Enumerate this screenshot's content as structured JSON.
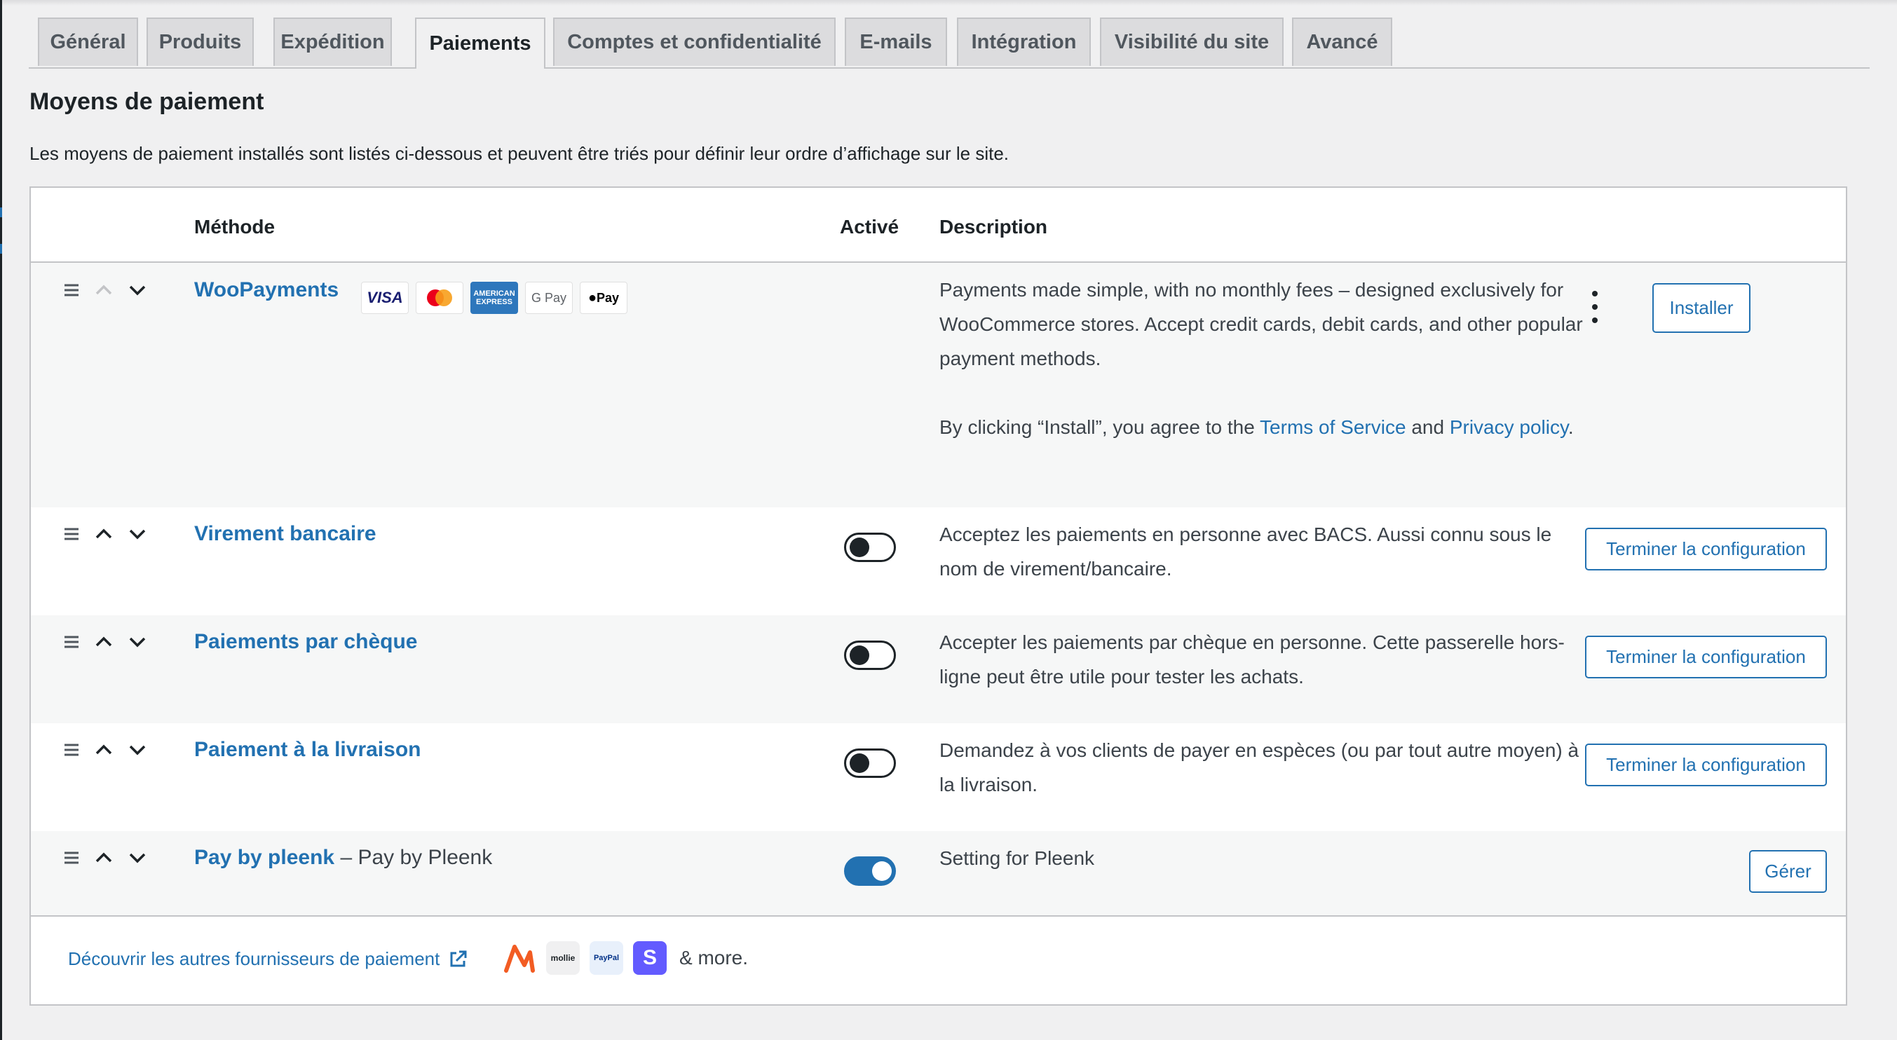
{
  "tabs": [
    "Général",
    "Produits",
    "Expédition",
    "Paiements",
    "Comptes et confidentialité",
    "E-mails",
    "Intégration",
    "Visibilité du site",
    "Avancé"
  ],
  "page": {
    "title": "Moyens de paiement",
    "description": "Les moyens de paiement installés sont listés ci-dessous et peuvent être triés pour définir leur ordre d’affichage sur le site."
  },
  "table": {
    "headers": {
      "method": "Méthode",
      "enabled": "Activé",
      "description": "Description"
    }
  },
  "woopayments": {
    "name": "WooPayments",
    "card_labels": {
      "visa": "VISA",
      "amex": "AMERICAN EXPRESS",
      "gpay": "G Pay",
      "applepay": "Pay"
    },
    "description": "Payments made simple, with no monthly fees – designed exclusively for WooCommerce stores. Accept credit cards, debit cards, and other popular payment methods.",
    "terms_prefix": "By clicking “Install”, you agree to the ",
    "terms_link": "Terms of Service",
    "terms_and": " and ",
    "privacy_link": "Privacy policy",
    "terms_suffix": ".",
    "install_label": "Installer"
  },
  "methods": [
    {
      "name": "Virement bancaire",
      "enabled": false,
      "description": "Acceptez les paiements en personne avec BACS. Aussi connu sous le nom de virement/bancaire.",
      "action": "Terminer la configuration"
    },
    {
      "name": "Paiements par chèque",
      "enabled": false,
      "description": "Accepter les paiements par chèque en personne. Cette passerelle hors-ligne peut être utile pour tester les achats.",
      "action": "Terminer la configuration"
    },
    {
      "name": "Paiement à la livraison",
      "enabled": false,
      "description": "Demandez à vos clients de payer en espèces (ou par tout autre moyen) à la livraison.",
      "action": "Terminer la configuration"
    },
    {
      "name": "Pay by pleenk",
      "name_suffix": " – Pay by Pleenk",
      "enabled": true,
      "description": "Setting for Pleenk",
      "action": "Gérer"
    }
  ],
  "footer": {
    "discover_label": "Découvrir les autres fournisseurs de paiement",
    "provider_labels": {
      "mollie": "mollie",
      "paypal": "PayPal",
      "stripe": "S"
    },
    "more": "& more."
  },
  "colors": {
    "link": "#2271b1",
    "toggle_on": "#2271b1",
    "background": "#f0f0f1"
  }
}
